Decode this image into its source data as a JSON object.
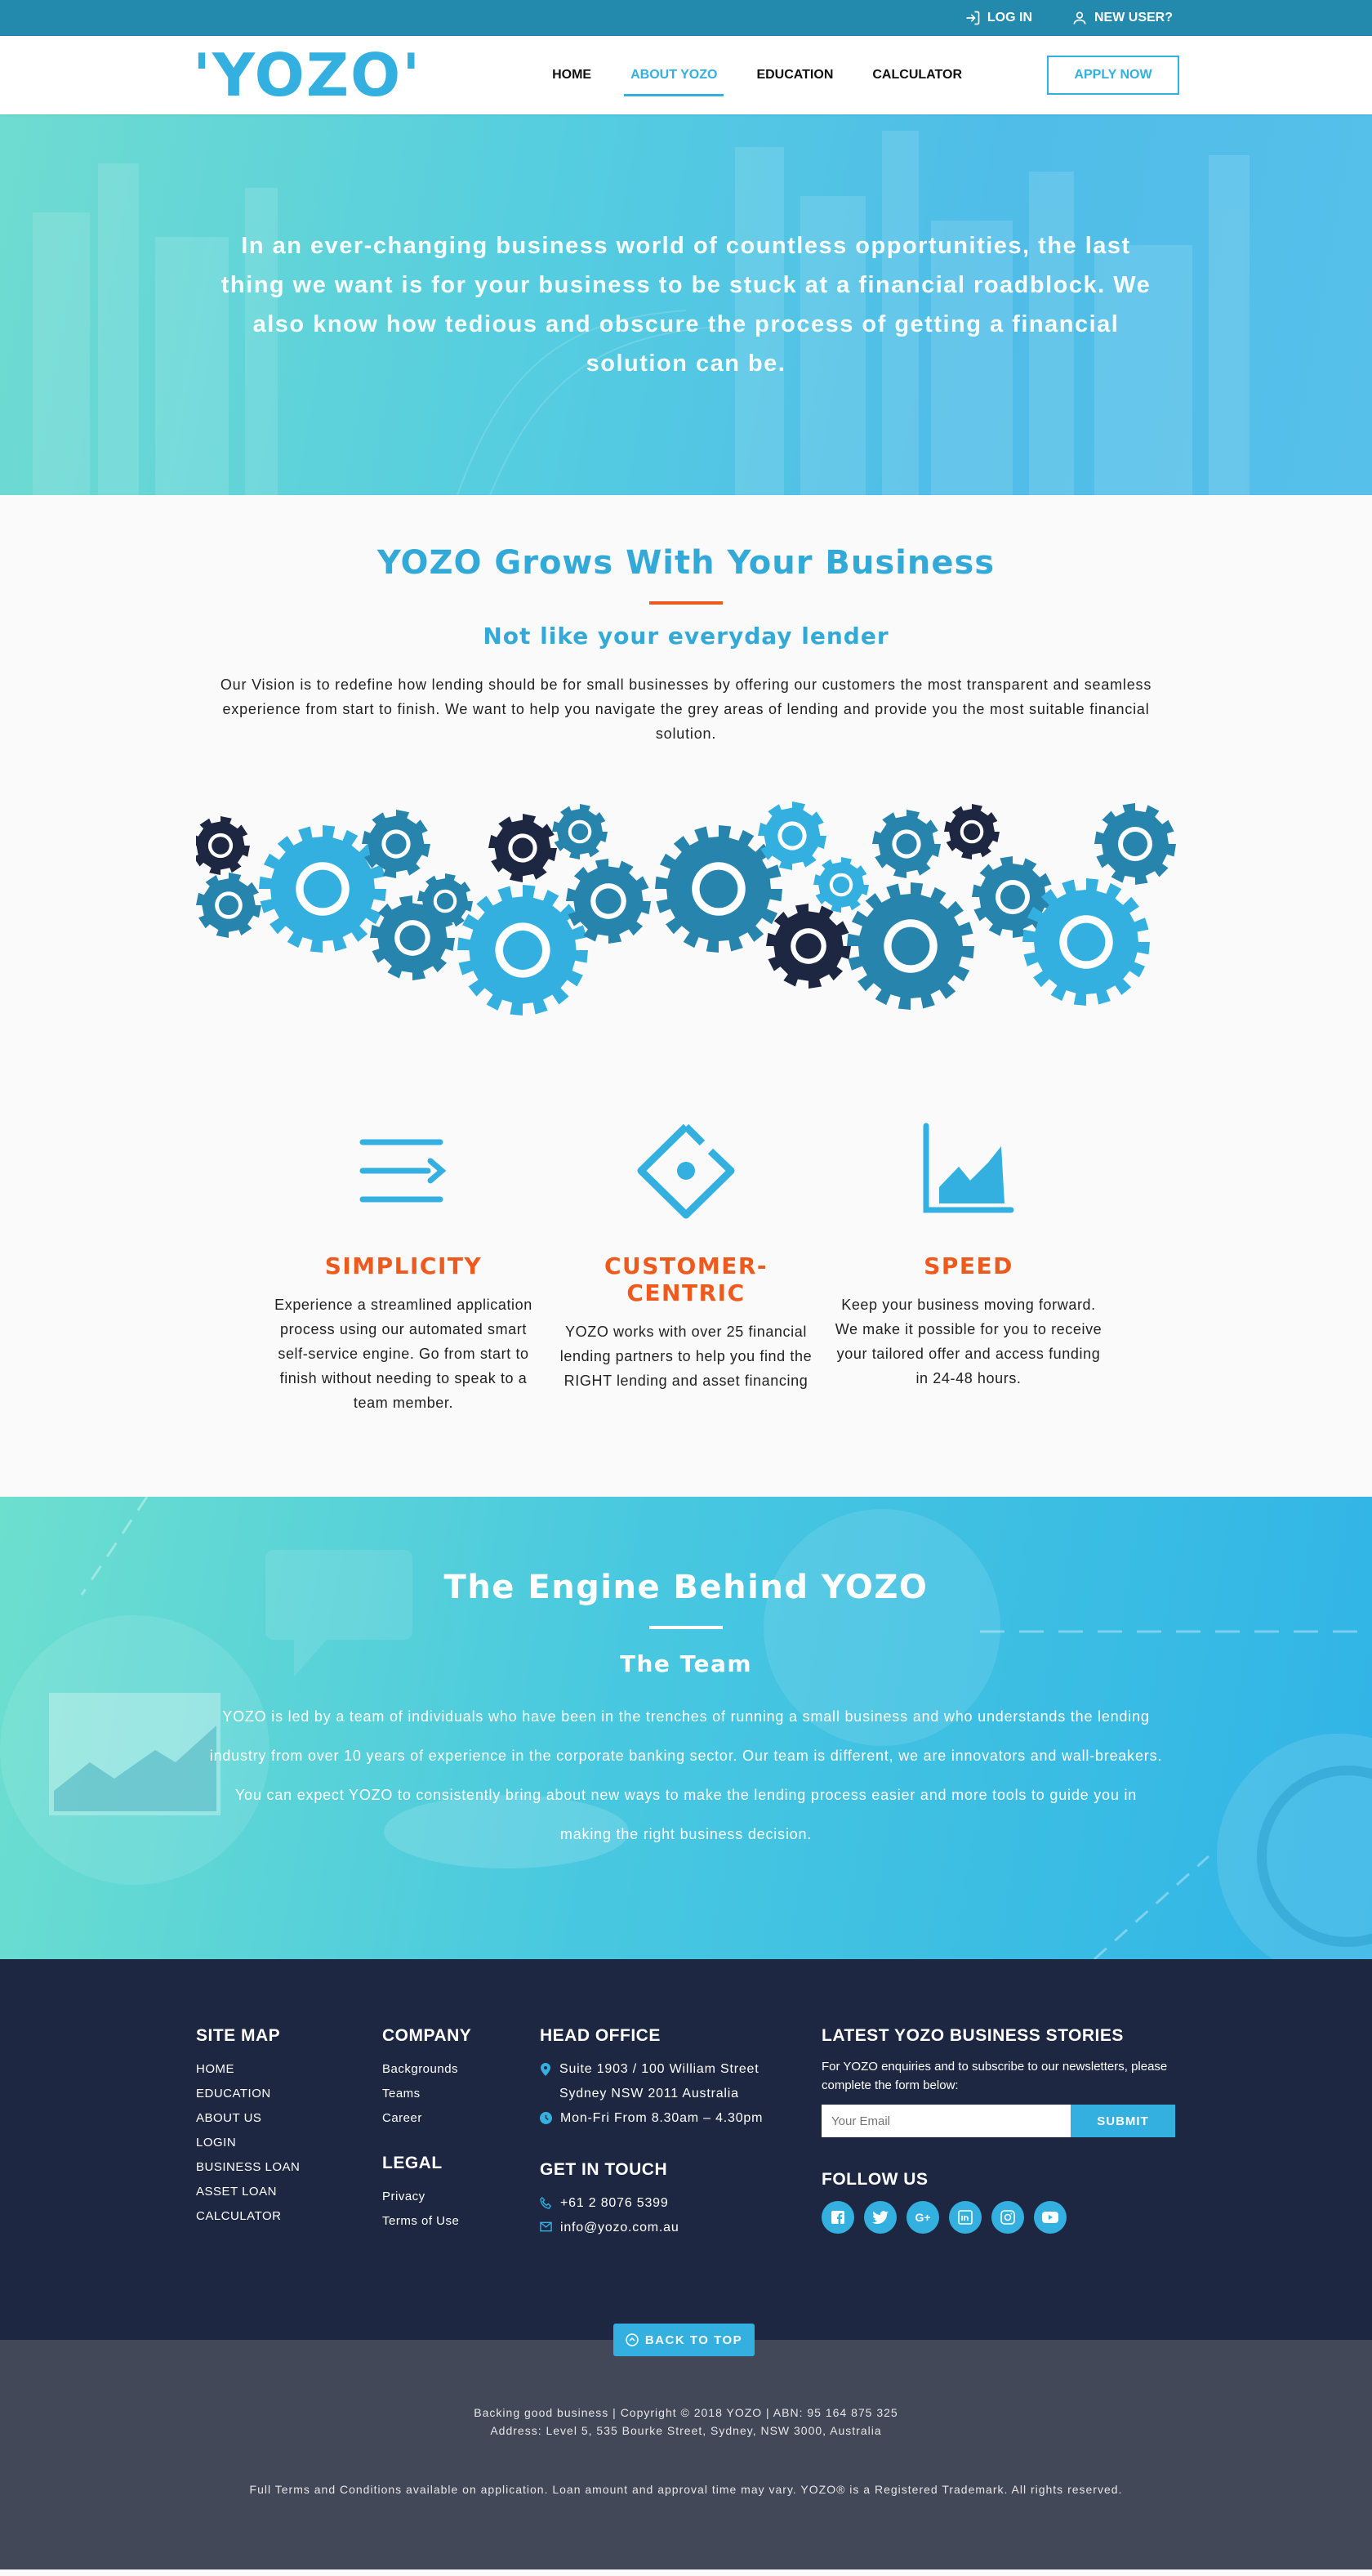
{
  "topbar": {
    "login": "LOG IN",
    "new_user": "NEW USER?"
  },
  "header": {
    "logo": "'YOZO'",
    "nav": [
      "HOME",
      "ABOUT YOZO",
      "EDUCATION",
      "CALCULATOR"
    ],
    "active_nav": "ABOUT YOZO",
    "apply": "APPLY NOW"
  },
  "hero": {
    "text": "In an ever-changing business world of countless opportunities, the last thing we want is for your business to be stuck at a financial roadblock. We also know how tedious and obscure the process of getting a financial solution can be."
  },
  "grows": {
    "title": "YOZO Grows With Your Business",
    "subtitle": "Not like your everyday lender",
    "body": "Our Vision is to redefine how lending should be for small businesses by offering our customers the most transparent and seamless experience from start to finish. We want to help you navigate the grey areas of lending and provide you the most suitable financial solution."
  },
  "features": [
    {
      "icon": "list-arrow-icon",
      "title": "SIMPLICITY",
      "body": "Experience a streamlined application process using our automated smart self-service engine. Go from start to finish without needing to speak to a team member."
    },
    {
      "icon": "diamond-target-icon",
      "title": "CUSTOMER-CENTRIC",
      "body": "YOZO works with over 25 financial lending partners to help you find the RIGHT lending and asset financing"
    },
    {
      "icon": "area-chart-icon",
      "title": "SPEED",
      "body": "Keep your business moving forward. We make it possible for you to receive your tailored offer and access funding in 24-48 hours."
    }
  ],
  "engine": {
    "title": "The Engine Behind YOZO",
    "subtitle": "The Team",
    "body": "YOZO is led by a team of individuals who have been in the trenches of running a small business and who understands the lending industry from over 10 years of experience in the corporate banking sector. Our team is different, we are innovators and wall-breakers. You can expect YOZO to consistently bring about new ways to make the lending process easier and more tools to guide you in making the right business decision."
  },
  "footer": {
    "sitemap": {
      "title": "SITE MAP",
      "items": [
        "HOME",
        "EDUCATION",
        "ABOUT US",
        "LOGIN",
        "BUSINESS LOAN",
        "ASSET LOAN",
        "CALCULATOR"
      ]
    },
    "company": {
      "title": "COMPANY",
      "items": [
        "Backgrounds",
        "Teams",
        "Career"
      ]
    },
    "legal": {
      "title": "LEGAL",
      "items": [
        "Privacy",
        "Terms of Use"
      ]
    },
    "head_office": {
      "title": "HEAD OFFICE",
      "address1": "Suite 1903 / 100 William Street",
      "address2": "Sydney NSW 2011 Australia",
      "hours": "Mon-Fri From 8.30am – 4.30pm"
    },
    "touch": {
      "title": "GET IN TOUCH",
      "phone": "+61 2 8076 5399",
      "email": "info@yozo.com.au"
    },
    "stories": {
      "title": "LATEST YOZO BUSINESS STORIES",
      "text": "For YOZO enquiries and to subscribe to our newsletters, please complete the form below:",
      "placeholder": "Your Email",
      "submit": "SUBMIT"
    },
    "follow": {
      "title": "FOLLOW US",
      "icons": [
        "facebook-icon",
        "twitter-icon",
        "google-plus-icon",
        "linkedin-icon",
        "instagram-icon",
        "youtube-icon"
      ]
    },
    "back_to_top": "BACK TO TOP"
  },
  "bottom": {
    "line1": "Backing good business | Copyright © 2018 YOZO | ABN: 95 164 875 325",
    "line2": "Address: Level 5, 535 Bourke Street, Sydney, NSW 3000, Australia",
    "legal": "Full Terms and Conditions available on application. Loan amount and approval time may vary. YOZO® is a Registered Trademark. All rights reserved."
  },
  "colors": {
    "brand_blue": "#33b0e0",
    "accent_orange": "#ee5a1e",
    "topbar": "#2389ad",
    "footer": "#1e2741",
    "bottom": "#434858"
  }
}
